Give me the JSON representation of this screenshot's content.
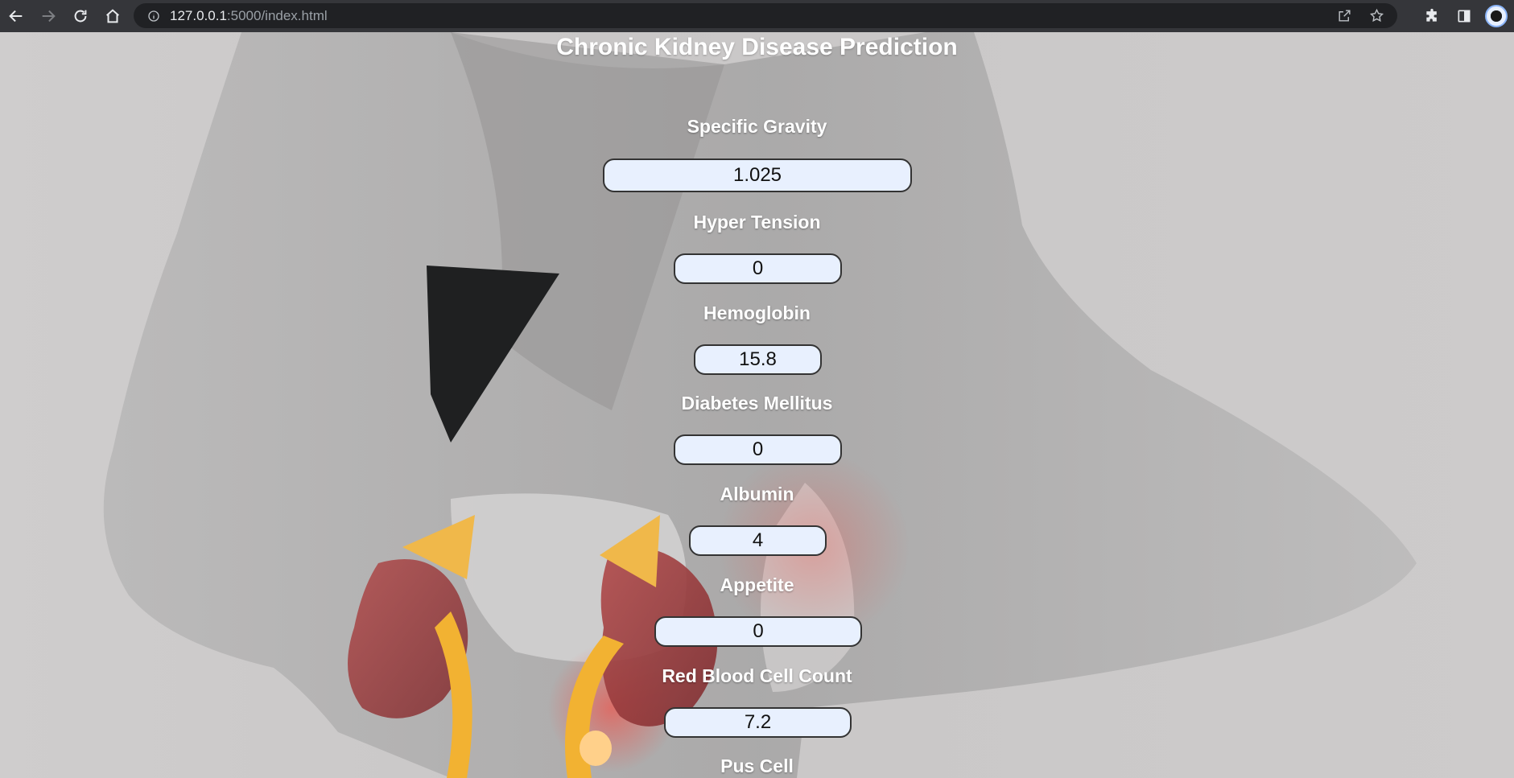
{
  "browser": {
    "url_host": "127.0.0.1",
    "url_path": ":5000/index.html"
  },
  "page": {
    "title": "Chronic Kidney Disease Prediction",
    "fields": [
      {
        "label": "Specific Gravity",
        "value": "1.025"
      },
      {
        "label": "Hyper Tension",
        "value": "0"
      },
      {
        "label": "Hemoglobin",
        "value": "15.8"
      },
      {
        "label": "Diabetes Mellitus",
        "value": "0"
      },
      {
        "label": "Albumin",
        "value": "4"
      },
      {
        "label": "Appetite",
        "value": "0"
      },
      {
        "label": "Red Blood Cell Count",
        "value": "7.2"
      },
      {
        "label": "Pus Cell",
        "value": ""
      }
    ]
  }
}
